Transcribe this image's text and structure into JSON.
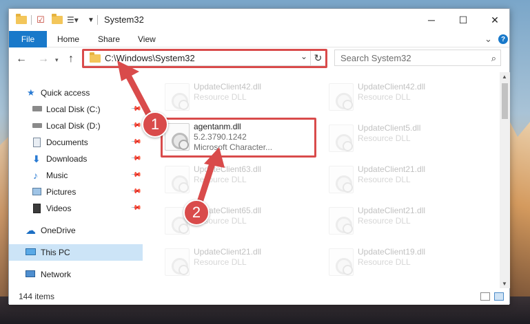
{
  "window": {
    "title": "System32",
    "minimize_glyph": "─",
    "maximize_glyph": "☐",
    "close_glyph": "✕"
  },
  "ribbon": {
    "file": "File",
    "tabs": [
      "Home",
      "Share",
      "View"
    ],
    "expand_glyph": "⌄",
    "help_glyph": "?"
  },
  "address": {
    "path": "C:\\Windows\\System32",
    "search_placeholder": "Search System32"
  },
  "nav": {
    "items": [
      {
        "label": "Quick access",
        "icon": "star-icon"
      },
      {
        "label": "Local Disk (C:)",
        "icon": "drive-icon"
      },
      {
        "label": "Local Disk (D:)",
        "icon": "drive-icon"
      },
      {
        "label": "Documents",
        "icon": "documents-icon"
      },
      {
        "label": "Downloads",
        "icon": "download-icon"
      },
      {
        "label": "Music",
        "icon": "music-icon"
      },
      {
        "label": "Pictures",
        "icon": "pictures-icon"
      },
      {
        "label": "Videos",
        "icon": "videos-icon"
      },
      {
        "label": "OneDrive",
        "icon": "cloud-icon"
      },
      {
        "label": "This PC",
        "icon": "computer-icon"
      },
      {
        "label": "Network",
        "icon": "network-icon"
      }
    ]
  },
  "files": {
    "col1": [
      {
        "name": "UpdateClient42.dll",
        "type": "Resource DLL"
      },
      {
        "name": "agentanm.dll",
        "version": "5.2.3790.1242",
        "desc": "Microsoft Character..."
      },
      {
        "name": "UpdateClient63.dll",
        "type": "Resource DLL"
      },
      {
        "name": "UpdateClient65.dll",
        "type": "Resource DLL"
      },
      {
        "name": "UpdateClient21.dll",
        "type": "Resource DLL"
      }
    ],
    "col2": [
      {
        "name": "UpdateClient42.dll",
        "type": "Resource DLL"
      },
      {
        "name": "UpdateClient5.dll",
        "type": "Resource DLL"
      },
      {
        "name": "UpdateClient21.dll",
        "type": "Resource DLL"
      },
      {
        "name": "UpdateClient21.dll",
        "type": "Resource DLL"
      },
      {
        "name": "UpdateClient19.dll",
        "type": "Resource DLL"
      }
    ]
  },
  "status": {
    "count": "144 items"
  },
  "annotations": {
    "step1": "1",
    "step2": "2",
    "color": "#d94b4b"
  }
}
